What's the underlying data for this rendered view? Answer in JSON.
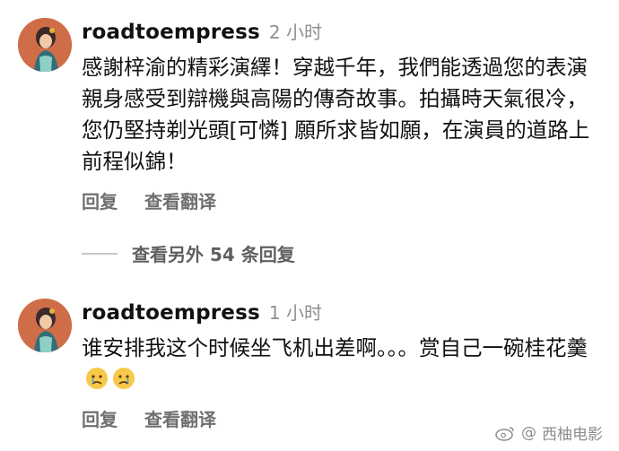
{
  "comments": [
    {
      "username": "roadtoempress",
      "time": "2 小时",
      "text": "感謝梓渝的精彩演繹！穿越千年，我們能透過您的表演親身感受到辯機與高陽的傳奇故事。拍攝時天氣很冷，您仍堅持剃光頭[可憐] 願所求皆如願，在演員的道路上前程似錦！",
      "reply_label": "回复",
      "translate_label": "查看翻译"
    },
    {
      "username": "roadtoempress",
      "time": "1 小时",
      "text": "谁安排我这个时候坐飞机出差啊。。。赏自己一碗桂花羹",
      "reply_label": "回复",
      "translate_label": "查看翻译"
    }
  ],
  "view_more_label": "查看另外 54 条回复",
  "watermark": {
    "at": "@",
    "text": "西柚电影"
  },
  "icons": {
    "avatar": "avatar-illustration-icon",
    "emoji": "crying-face-emoji-icon",
    "watermark": "weibo-logo-icon"
  }
}
